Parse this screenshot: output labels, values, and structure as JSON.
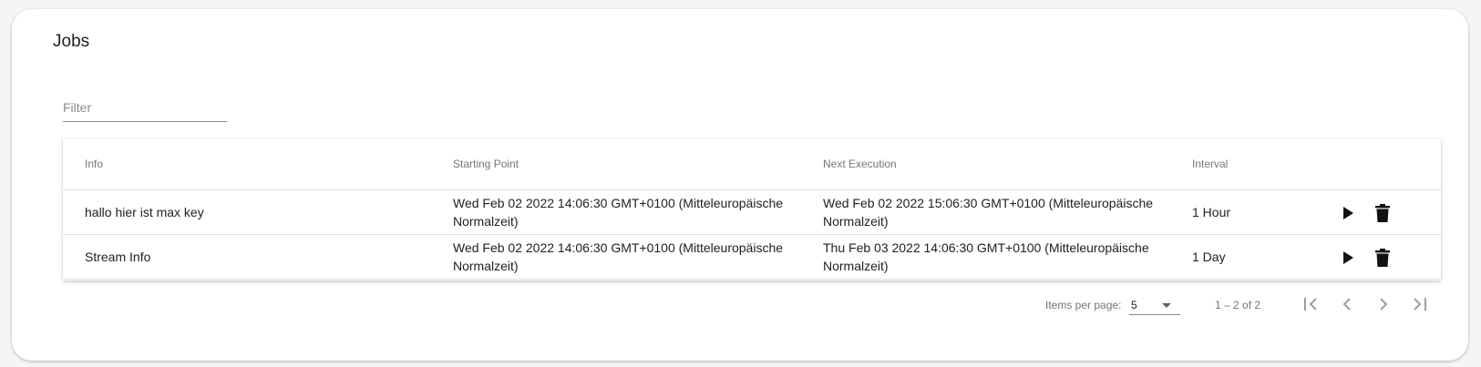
{
  "card": {
    "title": "Jobs"
  },
  "filter": {
    "placeholder": "Filter",
    "value": ""
  },
  "table": {
    "headers": {
      "info": "Info",
      "starting_point": "Starting Point",
      "next_execution": "Next Execution",
      "interval": "Interval"
    },
    "rows": [
      {
        "info": "hallo hier ist max key",
        "starting_point_line1": "Wed Feb 02 2022 14:06:30 GMT+0100 (Mitteleuropäische",
        "starting_point_line2": "Normalzeit)",
        "next_execution_line1": "Wed Feb 02 2022 15:06:30 GMT+0100 (Mitteleuropäische",
        "next_execution_line2": "Normalzeit)",
        "interval": "1 Hour"
      },
      {
        "info": "Stream Info",
        "starting_point_line1": "Wed Feb 02 2022 14:06:30 GMT+0100 (Mitteleuropäische",
        "starting_point_line2": "Normalzeit)",
        "next_execution_line1": "Thu Feb 03 2022 14:06:30 GMT+0100 (Mitteleuropäische",
        "next_execution_line2": "Normalzeit)",
        "interval": "1 Day"
      }
    ],
    "row_actions": [
      "play-icon",
      "delete-icon"
    ]
  },
  "paginator": {
    "items_per_page_label": "Items per page:",
    "items_per_page_value": "5",
    "range_label": "1 – 2 of 2",
    "buttons": [
      "first-page-icon",
      "previous-page-icon",
      "next-page-icon",
      "last-page-icon"
    ]
  },
  "colors": {
    "background": "#f5f5f5",
    "card": "#ffffff",
    "text": "#212121",
    "secondary_text": "#757575",
    "divider": "#e0e0e0",
    "icon": "#111111",
    "disabled_icon": "#9e9e9e"
  }
}
